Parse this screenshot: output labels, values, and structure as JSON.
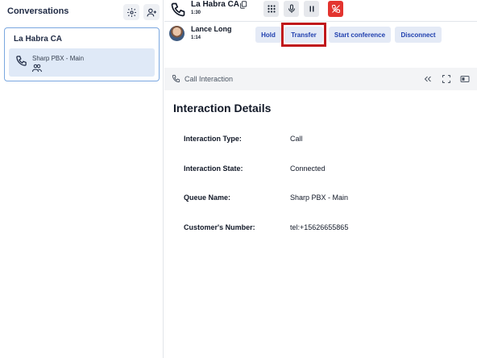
{
  "sidebar": {
    "title": "Conversations",
    "settings_icon": "gear-icon",
    "add_contact_icon": "add-person-icon",
    "conversation": {
      "title": "La Habra CA",
      "item_label": "Sharp PBX - Main",
      "item_icon": "phone-icon",
      "participants_icon": "people-icon"
    }
  },
  "call_bar": {
    "name": "La Habra CA",
    "duration": "1:30",
    "copy_icon": "copy-icon",
    "controls": [
      "dialpad-icon",
      "microphone-icon",
      "pause-icon",
      "hang-up-icon"
    ],
    "hang_up_color": "#e3342f"
  },
  "participant": {
    "name": "Lance Long",
    "duration": "1:14",
    "actions": {
      "hold": "Hold",
      "transfer": "Transfer",
      "conference": "Start conference",
      "disconnect": "Disconnect"
    },
    "highlight_color": "#c0171b"
  },
  "interaction_panel": {
    "label": "Call Interaction",
    "icons": [
      "collapse-icon",
      "expand-icon",
      "panel-toggle-icon"
    ]
  },
  "details": {
    "title": "Interaction Details",
    "rows": [
      {
        "label": "Interaction Type:",
        "value": "Call"
      },
      {
        "label": "Interaction State:",
        "value": "Connected"
      },
      {
        "label": "Queue Name:",
        "value": "Sharp PBX - Main"
      },
      {
        "label": "Customer's Number:",
        "value": "tel:+15626655865"
      }
    ]
  }
}
